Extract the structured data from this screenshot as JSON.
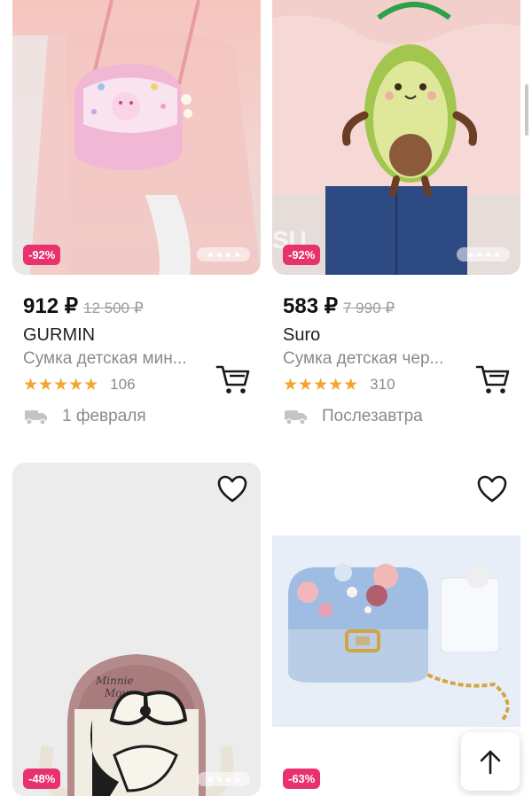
{
  "products": [
    {
      "discount": "-92%",
      "price": "912 ₽",
      "old_price": "12 500 ₽",
      "brand": "GURMIN",
      "description": "Сумка детская мин...",
      "rating_count": "106",
      "delivery": "1 февраля"
    },
    {
      "discount": "-92%",
      "price": "583 ₽",
      "old_price": "7 990 ₽",
      "brand": "Suro",
      "description": "Сумка детская чер...",
      "rating_count": "310",
      "delivery": "Послезавтра"
    },
    {
      "discount": "-48%"
    },
    {
      "discount": "-63%"
    }
  ],
  "stars": "★★★★★",
  "icons": {
    "cart": "cart-icon",
    "heart": "heart-icon",
    "truck": "truck-icon",
    "scroll_top": "arrow-up-icon"
  },
  "colors": {
    "badge": "#e7326e",
    "star": "#f4a531",
    "muted_text": "#8a8a8a"
  }
}
